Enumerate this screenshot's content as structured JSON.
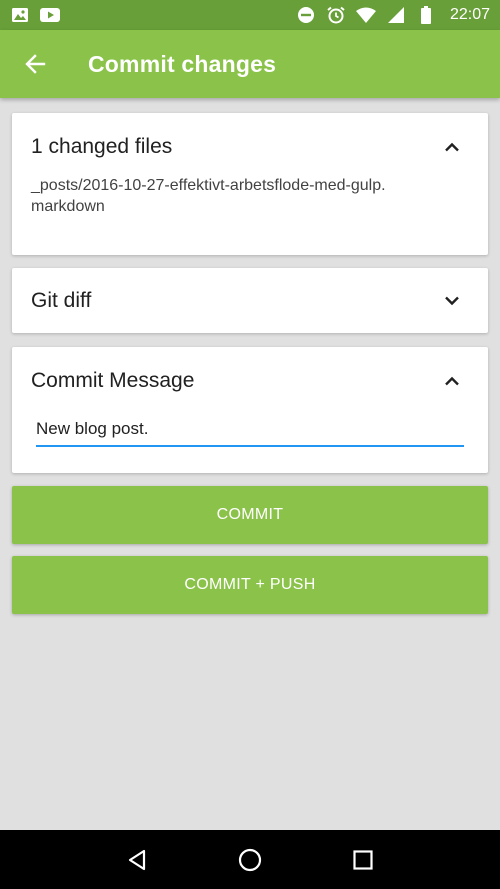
{
  "status_bar": {
    "time": "22:07",
    "icons": [
      "image-icon",
      "youtube-icon",
      "do-not-disturb-icon",
      "alarm-icon",
      "wifi-icon",
      "signal-icon",
      "battery-icon"
    ]
  },
  "app_bar": {
    "title": "Commit changes",
    "back_icon": "arrow-back-icon"
  },
  "changed_files": {
    "title": "1 changed files",
    "files": [
      "_posts/2016-10-27-effektivt-arbetsflode-med-gulp.markdown"
    ],
    "expanded": true
  },
  "git_diff": {
    "title": "Git diff",
    "expanded": false
  },
  "commit_message": {
    "title": "Commit Message",
    "value": "New blog post.",
    "expanded": true
  },
  "actions": {
    "commit_label": "COMMIT",
    "commit_push_label": "COMMIT + PUSH"
  },
  "colors": {
    "primary": "#8bc34a",
    "primary_dark": "#689f38",
    "accent": "#2196f3",
    "background": "#e0e0e0"
  }
}
